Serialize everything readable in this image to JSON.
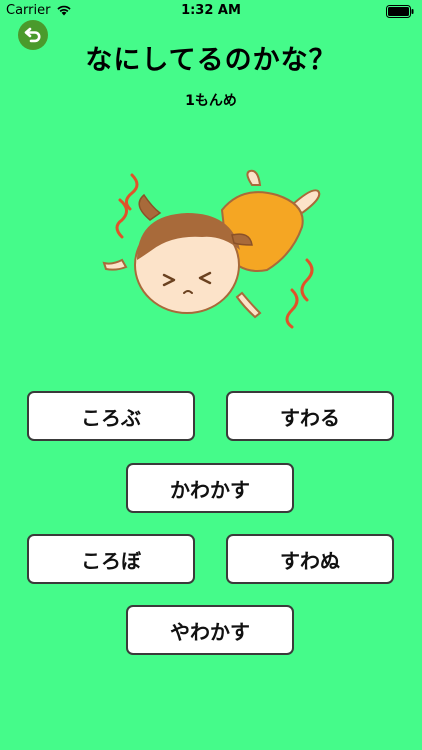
{
  "status_bar": {
    "carrier": "Carrier",
    "time": "1:32 AM",
    "icons": [
      "wifi-icon",
      "battery-icon"
    ]
  },
  "header": {
    "back_icon": "back-arrow-icon",
    "title": "なにしてるのかな？",
    "question_counter": "1もんめ"
  },
  "illustration": {
    "subject": "girl-falling-illustration"
  },
  "answers": [
    {
      "label": "ころぶ"
    },
    {
      "label": "すわる"
    },
    {
      "label": "かわかす"
    },
    {
      "label": "ころぼ"
    },
    {
      "label": "すわぬ"
    },
    {
      "label": "やわかす"
    }
  ],
  "colors": {
    "background": "#45fb8a",
    "back_button": "#4a9a2c",
    "button_fill": "#ffffff",
    "button_border": "#3a3a3a",
    "dress": "#f5a623",
    "hair": "#a86a3a",
    "motion_lines": "#e0522a"
  }
}
